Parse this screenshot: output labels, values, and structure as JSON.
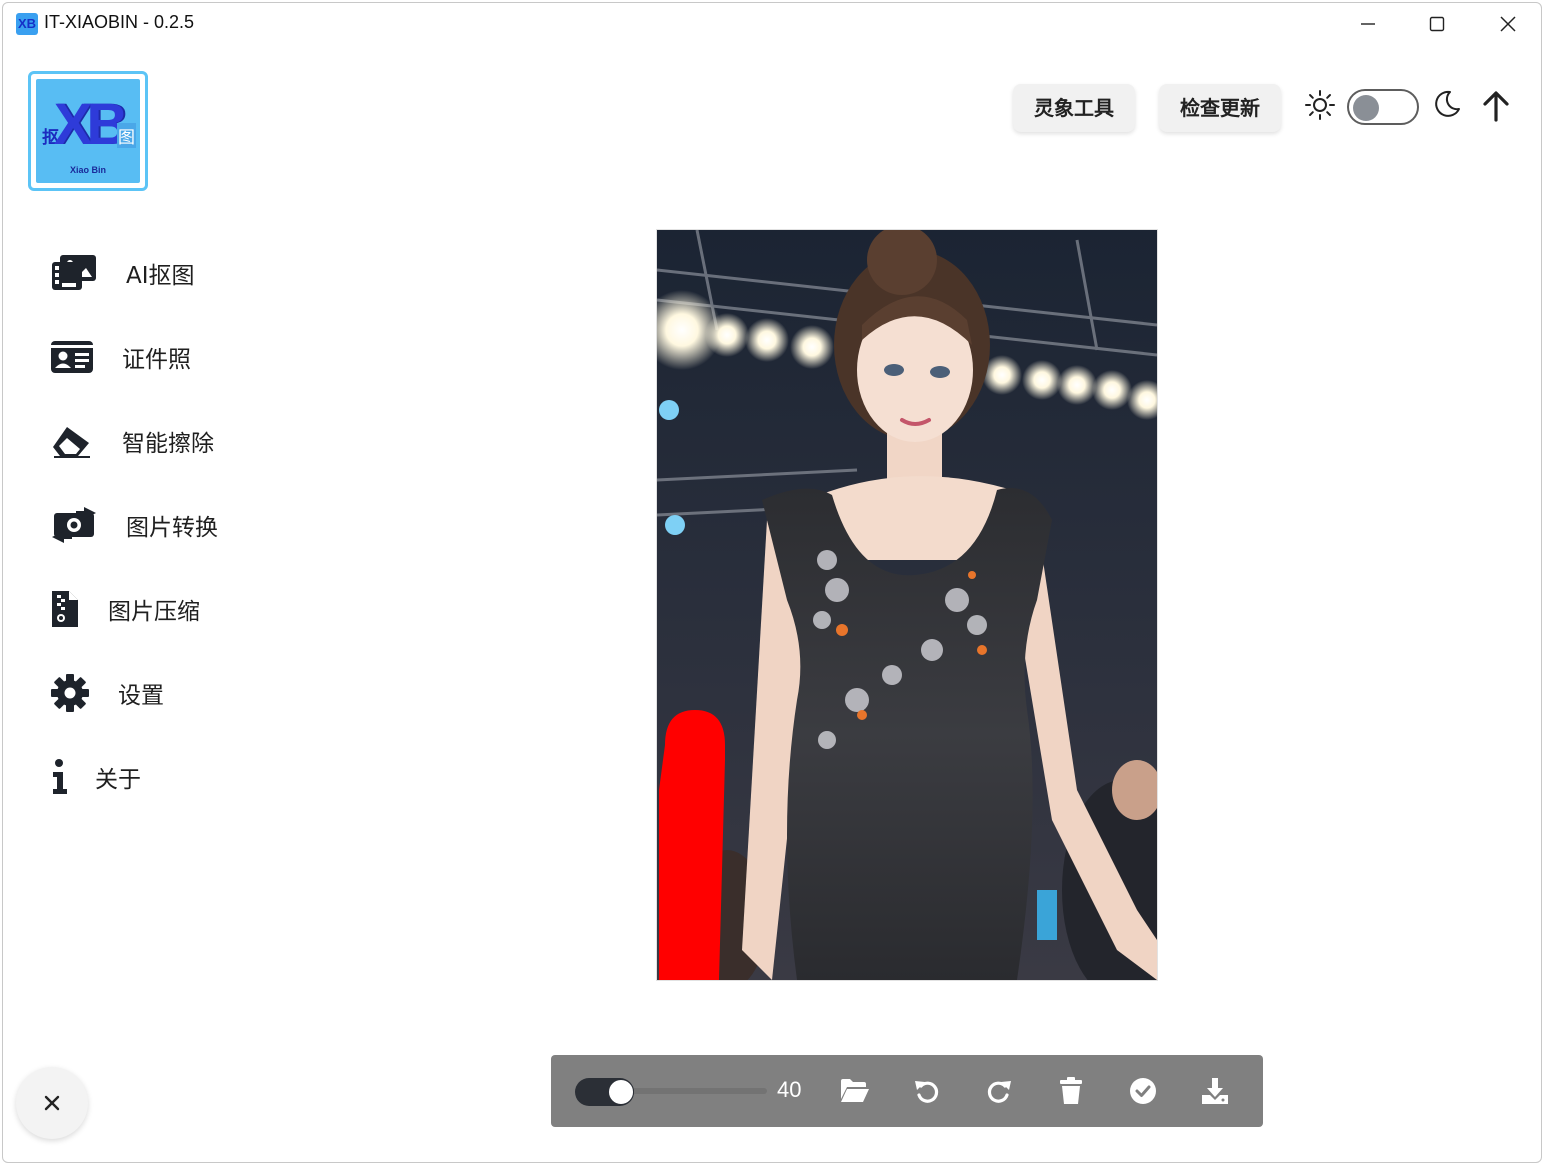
{
  "window": {
    "title": "IT-XIAOBIN - 0.2.5",
    "icon": "app-xb-icon",
    "controls": [
      "minimize-icon",
      "maximize-icon",
      "close-icon"
    ]
  },
  "logo": {
    "main": "XB",
    "left_char": "抠",
    "right_char": "图",
    "sub": "Xiao Bin",
    "color": "#58bdf3",
    "border_color": "#5cc4f6"
  },
  "header": {
    "lingxiang_label": "灵象工具",
    "update_label": "检查更新",
    "theme": {
      "light_icon": "sun-icon",
      "dark_icon": "moon-icon",
      "is_dark": false
    },
    "up_icon": "arrow-up-icon"
  },
  "sidebar": {
    "items": [
      {
        "label": "AI抠图",
        "icon": "images-icon"
      },
      {
        "label": "证件照",
        "icon": "id-card-icon"
      },
      {
        "label": "智能擦除",
        "icon": "eraser-icon"
      },
      {
        "label": "图片转换",
        "icon": "money-bill-transfer-icon"
      },
      {
        "label": "图片压缩",
        "icon": "file-zipper-icon"
      },
      {
        "label": "设置",
        "icon": "gear-icon"
      },
      {
        "label": "关于",
        "icon": "info-icon"
      }
    ]
  },
  "canvas": {
    "mask_color": "#ff0000"
  },
  "toolbar": {
    "brush_size": "40",
    "brush_fraction": 0.2,
    "icons": [
      "folder-open-icon",
      "undo-icon",
      "redo-icon",
      "trash-icon",
      "check-circle-icon",
      "download-icon"
    ],
    "background": "#808080"
  },
  "close_fab": {
    "icon": "close-icon"
  }
}
